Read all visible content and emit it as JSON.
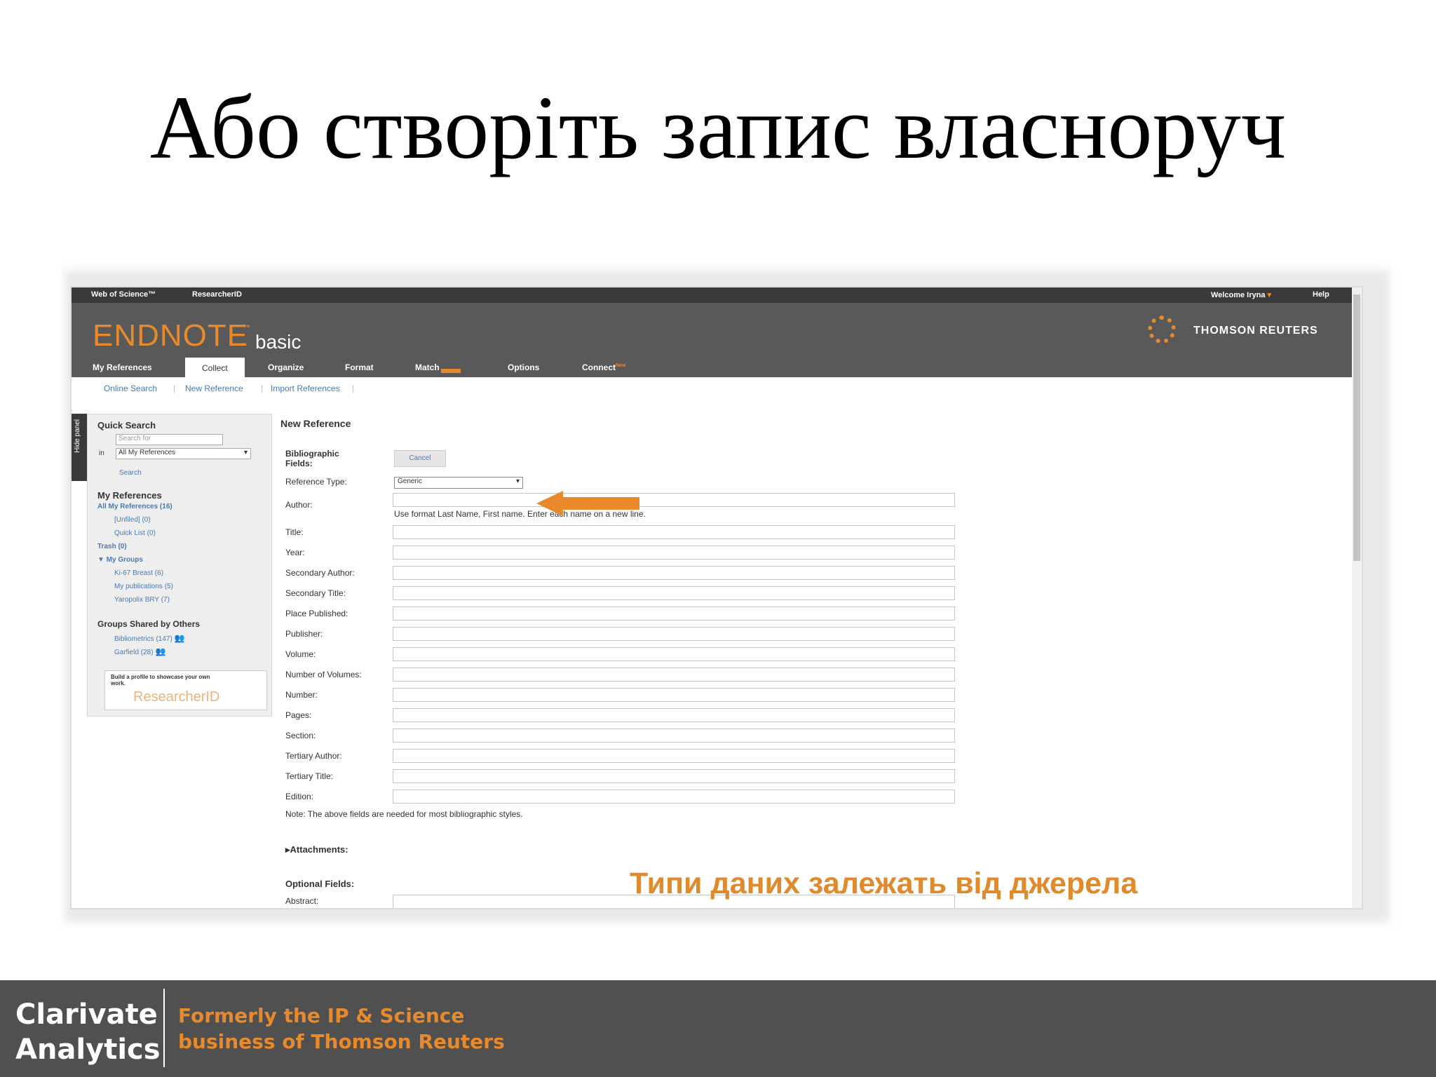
{
  "slide_title": "Або створіть запис власноруч",
  "caption": "Типи даних залежать від джерела",
  "top_bar": {
    "links": [
      "Web of Science™",
      "ResearcherID"
    ],
    "welcome": "Welcome Iryna",
    "help": "Help"
  },
  "logo": {
    "endnote": "ENDNOTE",
    "tm": "™",
    "basic": "basic",
    "partner": "THOMSON REUTERS"
  },
  "nav_tabs": [
    "My References",
    "Collect",
    "Organize",
    "Format",
    "Match",
    "Options",
    "Connect"
  ],
  "connect_suffix": "New",
  "active_tab": "Collect",
  "sub_tabs": [
    "Online Search",
    "New Reference",
    "Import References"
  ],
  "hide_panel": "Hide panel",
  "sidebar": {
    "quick_search_title": "Quick Search",
    "search_placeholder": "Search for",
    "in_label": "in",
    "scope": "All My References",
    "search_btn": "Search",
    "my_refs_title": "My References",
    "my_refs_items": [
      "All My References (16)",
      "[Unfiled] (0)",
      "Quick List (0)",
      "Trash (0)",
      "▼ My Groups",
      "Ki-67 Breast (6)",
      "My publications (5)",
      "Yaropolix BRY (7)"
    ],
    "shared_title": "Groups Shared by Others",
    "shared_items": [
      "Bibliometrics (147)",
      "Garfield (28)"
    ],
    "promo_text": "Build a profile to showcase your own work.",
    "promo_brand": "ResearcherID"
  },
  "form": {
    "title": "New Reference",
    "bib_label": "Bibliographic Fields:",
    "cancel": "Cancel",
    "ref_type_label": "Reference Type:",
    "ref_type_value": "Generic",
    "author_label": "Author:",
    "author_hint": "Use format Last Name, First name. Enter each name on a new line.",
    "fields": [
      "Title:",
      "Year:",
      "Secondary Author:",
      "Secondary Title:",
      "Place Published:",
      "Publisher:",
      "Volume:",
      "Number of Volumes:",
      "Number:",
      "Pages:",
      "Section:",
      "Tertiary Author:",
      "Tertiary Title:",
      "Edition:"
    ],
    "note": "Note: The above fields are needed for most bibliographic styles.",
    "attachments": "▸Attachments:",
    "optional": "Optional Fields:",
    "abstract": "Abstract:"
  },
  "footer": {
    "brand_line1": "Clarivate",
    "brand_line2": "Analytics",
    "tag_line1": "Formerly the IP & Science",
    "tag_line2": "business of Thomson Reuters"
  },
  "colors": {
    "accent": "#e8892b",
    "header": "#595959",
    "footer": "#505050",
    "link": "#4a7ab0"
  },
  "icons": [
    "dropdown-arrow-icon",
    "group-share-icon",
    "left-arrow-icon",
    "globe-logo-icon"
  ]
}
